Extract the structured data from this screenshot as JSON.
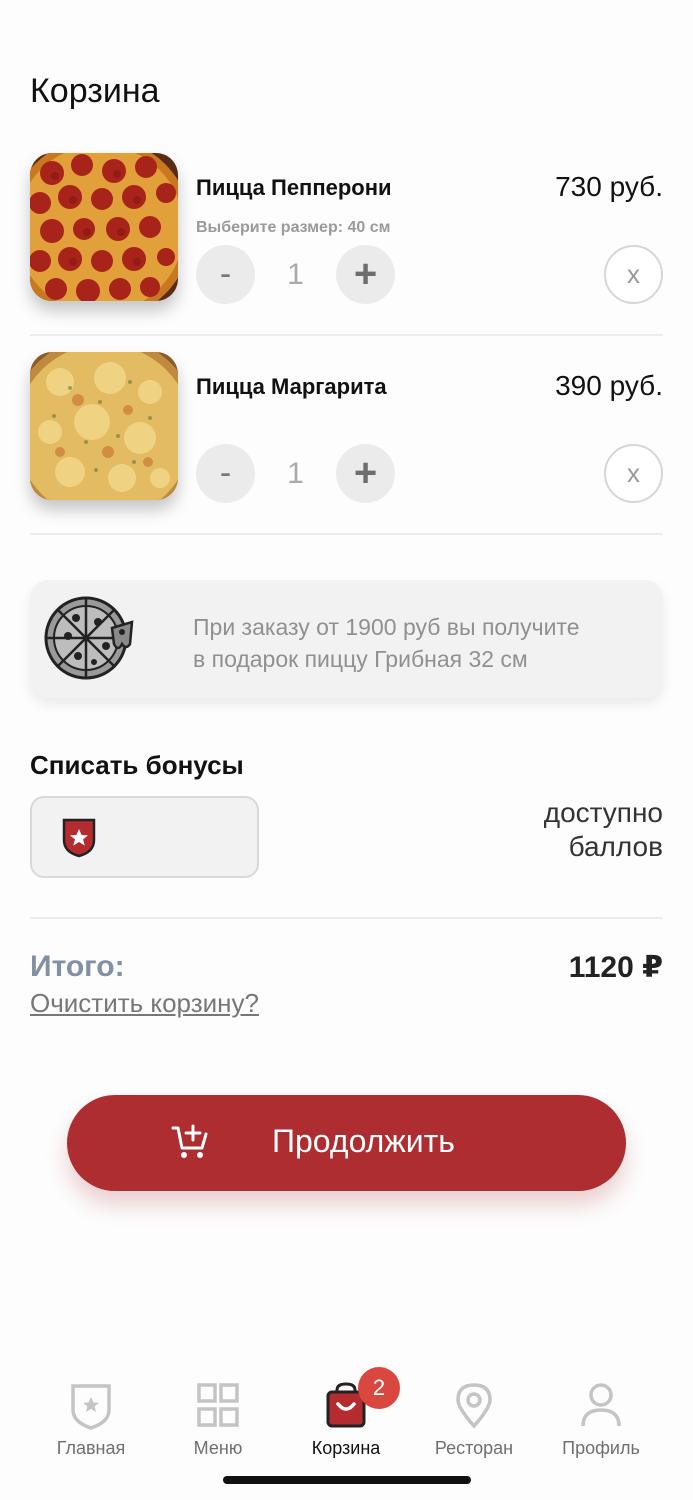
{
  "header": {
    "title": "Корзина"
  },
  "cart": {
    "items": [
      {
        "name": "Пицца Пепперони",
        "option": "Выберите размер: 40 см",
        "price": "730 руб.",
        "qty": "1",
        "minus": "-",
        "plus": "+",
        "remove": "x"
      },
      {
        "name": "Пицца Маргарита",
        "option": "",
        "price": "390 руб.",
        "qty": "1",
        "minus": "-",
        "plus": "+",
        "remove": "x"
      }
    ]
  },
  "promo": {
    "line1": "При заказу от 1900 руб вы получите",
    "line2": "в подарок пиццу Грибная 32 см",
    "icon": "pizza-icon"
  },
  "bonus": {
    "title": "Списать бонусы",
    "input_value": "",
    "available_line1": "доступно",
    "available_line2": "баллов",
    "icon": "shield-star-icon"
  },
  "summary": {
    "total_label": "Итого:",
    "total_value": "1120 ₽",
    "clear_link": "Очистить корзину?"
  },
  "actions": {
    "continue_label": "Продолжить",
    "icon": "cart-plus-icon"
  },
  "tabbar": {
    "items": [
      {
        "label": "Главная",
        "icon": "shield-star-icon"
      },
      {
        "label": "Меню",
        "icon": "grid-icon"
      },
      {
        "label": "Корзина",
        "icon": "bag-icon",
        "badge": "2",
        "active": true
      },
      {
        "label": "Ресторан",
        "icon": "location-pin-icon"
      },
      {
        "label": "Профиль",
        "icon": "user-icon"
      }
    ]
  },
  "colors": {
    "accent": "#ad2d31",
    "badge": "#d9473e",
    "total_label": "#8290a3"
  }
}
